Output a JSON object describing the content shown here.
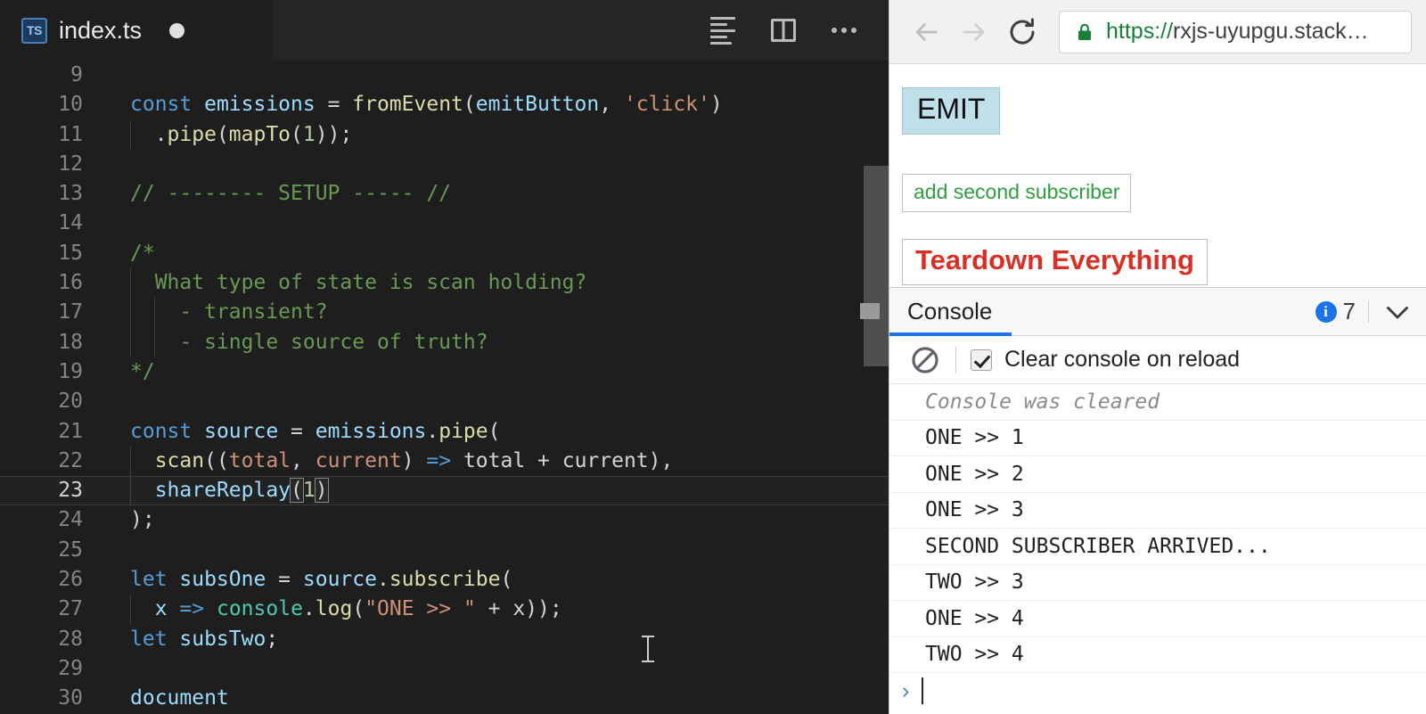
{
  "editor": {
    "tab": {
      "file_icon_label": "TS",
      "filename": "index.ts",
      "dirty": true
    },
    "actions": {
      "outline": "outline-icon",
      "split": "split-editor-icon",
      "more": "more-actions-icon"
    },
    "lines": [
      {
        "no": "9",
        "active": false,
        "tokens": []
      },
      {
        "no": "10",
        "active": false,
        "tokens": [
          {
            "t": "const ",
            "c": "kw"
          },
          {
            "t": "emissions",
            "c": "var"
          },
          {
            "t": " = ",
            "c": "op"
          },
          {
            "t": "fromEvent",
            "c": "fn"
          },
          {
            "t": "(",
            "c": "op"
          },
          {
            "t": "emitButton",
            "c": "var"
          },
          {
            "t": ", ",
            "c": "op"
          },
          {
            "t": "'click'",
            "c": "str"
          },
          {
            "t": ")",
            "c": "op"
          }
        ]
      },
      {
        "no": "11",
        "active": false,
        "indent": 1,
        "tokens": [
          {
            "t": "  .",
            "c": "op"
          },
          {
            "t": "pipe",
            "c": "fn"
          },
          {
            "t": "(",
            "c": "op"
          },
          {
            "t": "mapTo",
            "c": "fn"
          },
          {
            "t": "(",
            "c": "op"
          },
          {
            "t": "1",
            "c": "num"
          },
          {
            "t": "));",
            "c": "op"
          }
        ]
      },
      {
        "no": "12",
        "active": false,
        "indent": 1,
        "tokens": []
      },
      {
        "no": "13",
        "active": false,
        "tokens": [
          {
            "t": "// -------- SETUP ----- //",
            "c": "cmt"
          }
        ]
      },
      {
        "no": "14",
        "active": false,
        "tokens": []
      },
      {
        "no": "15",
        "active": false,
        "tokens": [
          {
            "t": "/*",
            "c": "cmt"
          }
        ]
      },
      {
        "no": "16",
        "active": false,
        "indent": 1,
        "tokens": [
          {
            "t": "  What type of state is scan holding?",
            "c": "cmt"
          }
        ]
      },
      {
        "no": "17",
        "active": false,
        "indent": 2,
        "tokens": [
          {
            "t": "    - transient?",
            "c": "cmt"
          }
        ]
      },
      {
        "no": "18",
        "active": false,
        "indent": 2,
        "tokens": [
          {
            "t": "    - single source of truth?",
            "c": "cmt"
          }
        ]
      },
      {
        "no": "19",
        "active": false,
        "tokens": [
          {
            "t": "*/",
            "c": "cmt"
          }
        ]
      },
      {
        "no": "20",
        "active": false,
        "tokens": []
      },
      {
        "no": "21",
        "active": false,
        "tokens": [
          {
            "t": "const ",
            "c": "kw"
          },
          {
            "t": "source",
            "c": "var"
          },
          {
            "t": " = ",
            "c": "op"
          },
          {
            "t": "emissions",
            "c": "var"
          },
          {
            "t": ".",
            "c": "op"
          },
          {
            "t": "pipe",
            "c": "fn"
          },
          {
            "t": "(",
            "c": "op"
          }
        ]
      },
      {
        "no": "22",
        "active": false,
        "indent": 1,
        "tokens": [
          {
            "t": "  ",
            "c": "op"
          },
          {
            "t": "scan",
            "c": "fn"
          },
          {
            "t": "((",
            "c": "op"
          },
          {
            "t": "total",
            "c": "str"
          },
          {
            "t": ", ",
            "c": "op"
          },
          {
            "t": "current",
            "c": "str"
          },
          {
            "t": ") ",
            "c": "op"
          },
          {
            "t": "=>",
            "c": "arrow"
          },
          {
            "t": " total + current),",
            "c": "op"
          }
        ]
      },
      {
        "no": "23",
        "active": true,
        "indent": 1,
        "tokens": [
          {
            "t": "  ",
            "c": "op"
          },
          {
            "t": "shareReplay",
            "c": "var"
          },
          {
            "t": "(",
            "c": "op bracket-match"
          },
          {
            "t": "1",
            "c": "num"
          },
          {
            "t": ")",
            "c": "op bracket-match"
          }
        ]
      },
      {
        "no": "24",
        "active": false,
        "tokens": [
          {
            "t": ");",
            "c": "op"
          }
        ]
      },
      {
        "no": "25",
        "active": false,
        "tokens": []
      },
      {
        "no": "26",
        "active": false,
        "tokens": [
          {
            "t": "let ",
            "c": "kw"
          },
          {
            "t": "subsOne",
            "c": "var"
          },
          {
            "t": " = ",
            "c": "op"
          },
          {
            "t": "source",
            "c": "var"
          },
          {
            "t": ".",
            "c": "op"
          },
          {
            "t": "subscribe",
            "c": "fn"
          },
          {
            "t": "(",
            "c": "op"
          }
        ]
      },
      {
        "no": "27",
        "active": false,
        "indent": 1,
        "tokens": [
          {
            "t": "  ",
            "c": "op"
          },
          {
            "t": "x",
            "c": "var"
          },
          {
            "t": " ",
            "c": "op"
          },
          {
            "t": "=>",
            "c": "arrow"
          },
          {
            "t": " ",
            "c": "op"
          },
          {
            "t": "console",
            "c": "cls"
          },
          {
            "t": ".",
            "c": "op"
          },
          {
            "t": "log",
            "c": "fn"
          },
          {
            "t": "(",
            "c": "op"
          },
          {
            "t": "\"ONE >> \"",
            "c": "str"
          },
          {
            "t": " + x));",
            "c": "op"
          }
        ]
      },
      {
        "no": "28",
        "active": false,
        "tokens": [
          {
            "t": "let ",
            "c": "kw"
          },
          {
            "t": "subsTwo",
            "c": "var"
          },
          {
            "t": ";",
            "c": "op"
          }
        ]
      },
      {
        "no": "29",
        "active": false,
        "tokens": []
      },
      {
        "no": "30",
        "active": false,
        "tokens": [
          {
            "t": "document",
            "c": "var"
          }
        ]
      }
    ]
  },
  "browser": {
    "back_label": "back-arrow-icon",
    "forward_label": "forward-arrow-icon",
    "reload_label": "reload-icon",
    "url_scheme": "https://",
    "url_rest": "rxjs-uyupgu.stack…",
    "lock": "lock-icon"
  },
  "preview": {
    "emit_label": "EMIT",
    "add_subscriber_label": "add second subscriber",
    "teardown_label": "Teardown Everything"
  },
  "console": {
    "tab_label": "Console",
    "badge_count": "7",
    "badge_icon": "info-icon",
    "collapse_icon": "chevron-down-icon",
    "clear_icon": "ban-icon",
    "clear_on_reload_label": "Clear console on reload",
    "clear_on_reload_checked": true,
    "prompt_caret": "›",
    "entries": [
      {
        "text": "Console was cleared",
        "type": "cleared"
      },
      {
        "text": "ONE >> 1",
        "type": "log"
      },
      {
        "text": "ONE >> 2",
        "type": "log"
      },
      {
        "text": "ONE >> 3",
        "type": "log"
      },
      {
        "text": "SECOND SUBSCRIBER ARRIVED...",
        "type": "log"
      },
      {
        "text": "TWO >> 3",
        "type": "log"
      },
      {
        "text": "ONE >> 4",
        "type": "log"
      },
      {
        "text": "TWO >> 4",
        "type": "log"
      }
    ]
  },
  "colors": {
    "editor_bg": "#1e1e1e",
    "tabbar_bg": "#252526",
    "accent_blue": "#1a73e8",
    "emit_bg": "#bfe0e8",
    "green_text": "#2f9e41",
    "red_text": "#d93025",
    "url_green": "#188038"
  }
}
